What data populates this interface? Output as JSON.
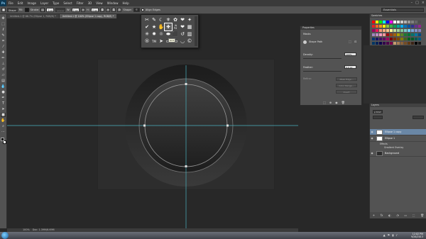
{
  "app": {
    "logo": "Ps",
    "menu": [
      "File",
      "Edit",
      "Image",
      "Layer",
      "Type",
      "Select",
      "Filter",
      "3D",
      "View",
      "Window",
      "Help"
    ],
    "window_controls": [
      "–",
      "□",
      "×"
    ]
  },
  "options_bar": {
    "tool_mode": "Shape",
    "fill_label": "Fill:",
    "stroke_label": "Stroke:",
    "stroke_width": "3 pt",
    "w_label": "W:",
    "w_value": "0 px",
    "h_label": "H:",
    "h_value": "0 px",
    "shape_label": "Shape:",
    "align_edges_label": "Align Edges",
    "workspace": "Essentials",
    "fill_color": "#1a1a1a",
    "stroke_color": "#888888"
  },
  "tabs": [
    {
      "label": "Untitled-1 @ 66.7% (Ellipse 1, RGB/8) *",
      "active": false
    },
    {
      "label": "Untitled-1 @ 100% (Ellipse 1 copy, RGB/8) *",
      "active": true
    }
  ],
  "tools": [
    {
      "icon": "move-icon",
      "glyph": "✥"
    },
    {
      "icon": "marquee-icon",
      "glyph": "⬚"
    },
    {
      "icon": "lasso-icon",
      "glyph": "ℓ"
    },
    {
      "icon": "quick-select-icon",
      "glyph": "✎"
    },
    {
      "icon": "crop-icon",
      "glyph": "⌗"
    },
    {
      "icon": "eyedropper-icon",
      "glyph": "⁄"
    },
    {
      "icon": "healing-brush-icon",
      "glyph": "✚"
    },
    {
      "icon": "brush-icon",
      "glyph": "✏"
    },
    {
      "icon": "clone-stamp-icon",
      "glyph": "⊥"
    },
    {
      "icon": "history-brush-icon",
      "glyph": "↺"
    },
    {
      "icon": "eraser-icon",
      "glyph": "▱"
    },
    {
      "icon": "gradient-icon",
      "glyph": "▤"
    },
    {
      "icon": "blur-icon",
      "glyph": "💧"
    },
    {
      "icon": "dodge-icon",
      "glyph": "●"
    },
    {
      "icon": "pen-icon",
      "glyph": "✒"
    },
    {
      "icon": "type-icon",
      "glyph": "T"
    },
    {
      "icon": "path-select-icon",
      "glyph": "➤"
    },
    {
      "icon": "shape-icon",
      "glyph": "■",
      "selected": true
    },
    {
      "icon": "hand-icon",
      "glyph": "✋"
    },
    {
      "icon": "zoom-icon",
      "glyph": "⌕"
    },
    {
      "icon": "extra-icon",
      "glyph": "⋯"
    }
  ],
  "shape_picker": {
    "shapes": [
      "✂",
      "✎",
      "☾",
      "⚜",
      "✿",
      "❤",
      "✦",
      "✔",
      "★",
      "✋",
      "✚",
      "♫",
      "❤",
      "▦",
      "✳",
      "✹",
      "☼",
      "⬬",
      "⬛",
      "↺",
      "▥",
      "®",
      "TM",
      "➤",
      "▭",
      "▭",
      "◡",
      "©"
    ],
    "highlight_index": 10,
    "tooltip": "Grid"
  },
  "swatches": {
    "title": "Swatches",
    "colors": [
      "#ff0000",
      "#ffff00",
      "#00ff00",
      "#00ffff",
      "#0000ff",
      "#ff00ff",
      "#ffffff",
      "#e6e6e6",
      "#cccccc",
      "#b3b3b3",
      "#999999",
      "#808080",
      "#666666",
      "#4d4d4d",
      "#ed1c24",
      "#f26522",
      "#f7941d",
      "#fff200",
      "#8dc63f",
      "#39b54a",
      "#00a651",
      "#00a99d",
      "#00aeef",
      "#0072bc",
      "#0054a6",
      "#2e3192",
      "#662d91",
      "#92278f",
      "#9e005d",
      "#ed145b",
      "#f69679",
      "#f9ad81",
      "#fdc689",
      "#fff799",
      "#c4df9b",
      "#a3d39c",
      "#82ca9c",
      "#7accc8",
      "#6dcff6",
      "#7da7d9",
      "#8393ca",
      "#8781bd",
      "#a186be",
      "#bd8cbf",
      "#f49ac1",
      "#f5989d",
      "#9e0b0f",
      "#a0410d",
      "#a36209",
      "#aba000",
      "#598527",
      "#1a7b30",
      "#007236",
      "#00746b",
      "#0076a3",
      "#004b80",
      "#003471",
      "#1b1464",
      "#440e62",
      "#630460",
      "#9e005d",
      "#790000",
      "#7b2e00",
      "#7d4900",
      "#827b00",
      "#406618",
      "#005e20",
      "#005826",
      "#005952",
      "#005b7f",
      "#003663",
      "#002157",
      "#0d004c",
      "#32004b",
      "#4b0049",
      "#7b0046",
      "#c69c6d",
      "#a67c52",
      "#8c6239",
      "#754c24",
      "#603913",
      "#3c2415",
      "#000000",
      "#1a1a1a"
    ]
  },
  "properties": {
    "title": "Properties",
    "section": "Masks",
    "mask_type": "Shape Path",
    "density_label": "Density:",
    "density_value": "100%",
    "feather_label": "Feather:",
    "feather_value": "0.0 px",
    "refine_label": "Refine:",
    "btn_mask_edge": "Mask Edge...",
    "btn_color_range": "Color Range...",
    "btn_invert": "Invert",
    "footer_icons": [
      "⬚",
      "⊕",
      "◉",
      "🗑"
    ]
  },
  "layers": {
    "title": "Layers",
    "kind": "ρ Kind",
    "rows": [
      {
        "name": "Ellipse 1 copy",
        "selected": true,
        "thumb": "#ffffff"
      },
      {
        "name": "Ellipse 1",
        "selected": false,
        "thumb": "#ffffff"
      },
      {
        "name": "Background",
        "selected": false,
        "thumb": "#2d2d2d"
      }
    ],
    "effects_label": "Effects",
    "gradient_overlay_label": "Gradient Overlay",
    "footer_icons": [
      "⚭",
      "fx",
      "◐",
      "◔",
      "▭",
      "⬚",
      "🗑"
    ]
  },
  "status": {
    "zoom": "100%",
    "doc_info": "Doc: 1.39M/6.69M"
  },
  "taskbar": {
    "time": "12:02 PM",
    "date": "9/26/2013",
    "tray_icons": [
      "▲",
      "⚑",
      "▮",
      "♪"
    ]
  }
}
